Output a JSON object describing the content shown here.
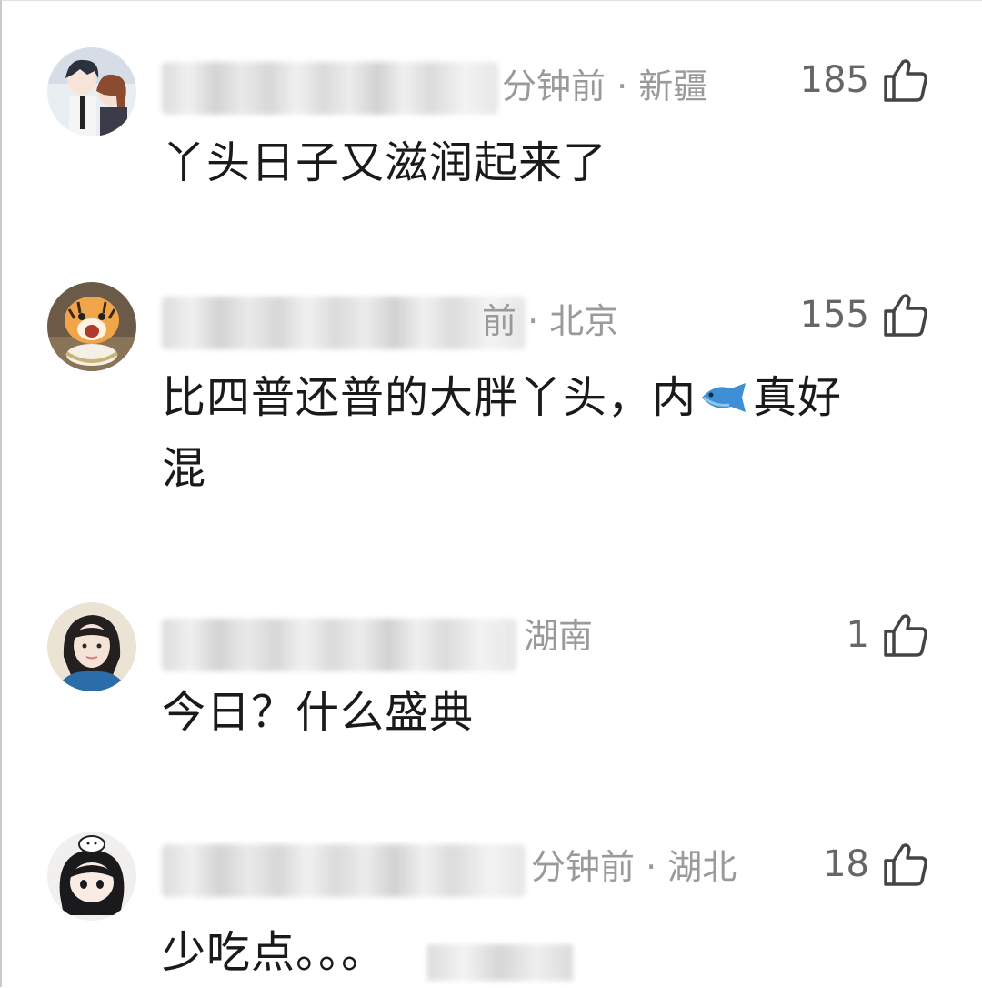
{
  "comments": [
    {
      "time_region": "分钟前 · 新疆",
      "likes": "185",
      "text": "丫头日子又滋润起来了",
      "avatar_icon": "anime-couple-avatar-icon"
    },
    {
      "time_region": "前 · 北京",
      "likes": "155",
      "text_before": "比四普还普的大胖丫头，内",
      "emoji_icon": "fish-emoji-icon",
      "text_after": "真好",
      "text_line2": "混",
      "avatar_icon": "tiger-cub-avatar-icon"
    },
    {
      "time_region": "湖南",
      "likes": "1",
      "text": "今日？什么盛典",
      "avatar_icon": "girl-photo-avatar-icon"
    },
    {
      "time_region": "分钟前 · 湖北",
      "likes": "18",
      "text": "少吃点。。。",
      "avatar_icon": "chibi-girl-avatar-icon"
    }
  ],
  "colors": {
    "meta_gray": "#9a9a9a",
    "like_gray": "#666666",
    "text": "#1a1a1a"
  }
}
